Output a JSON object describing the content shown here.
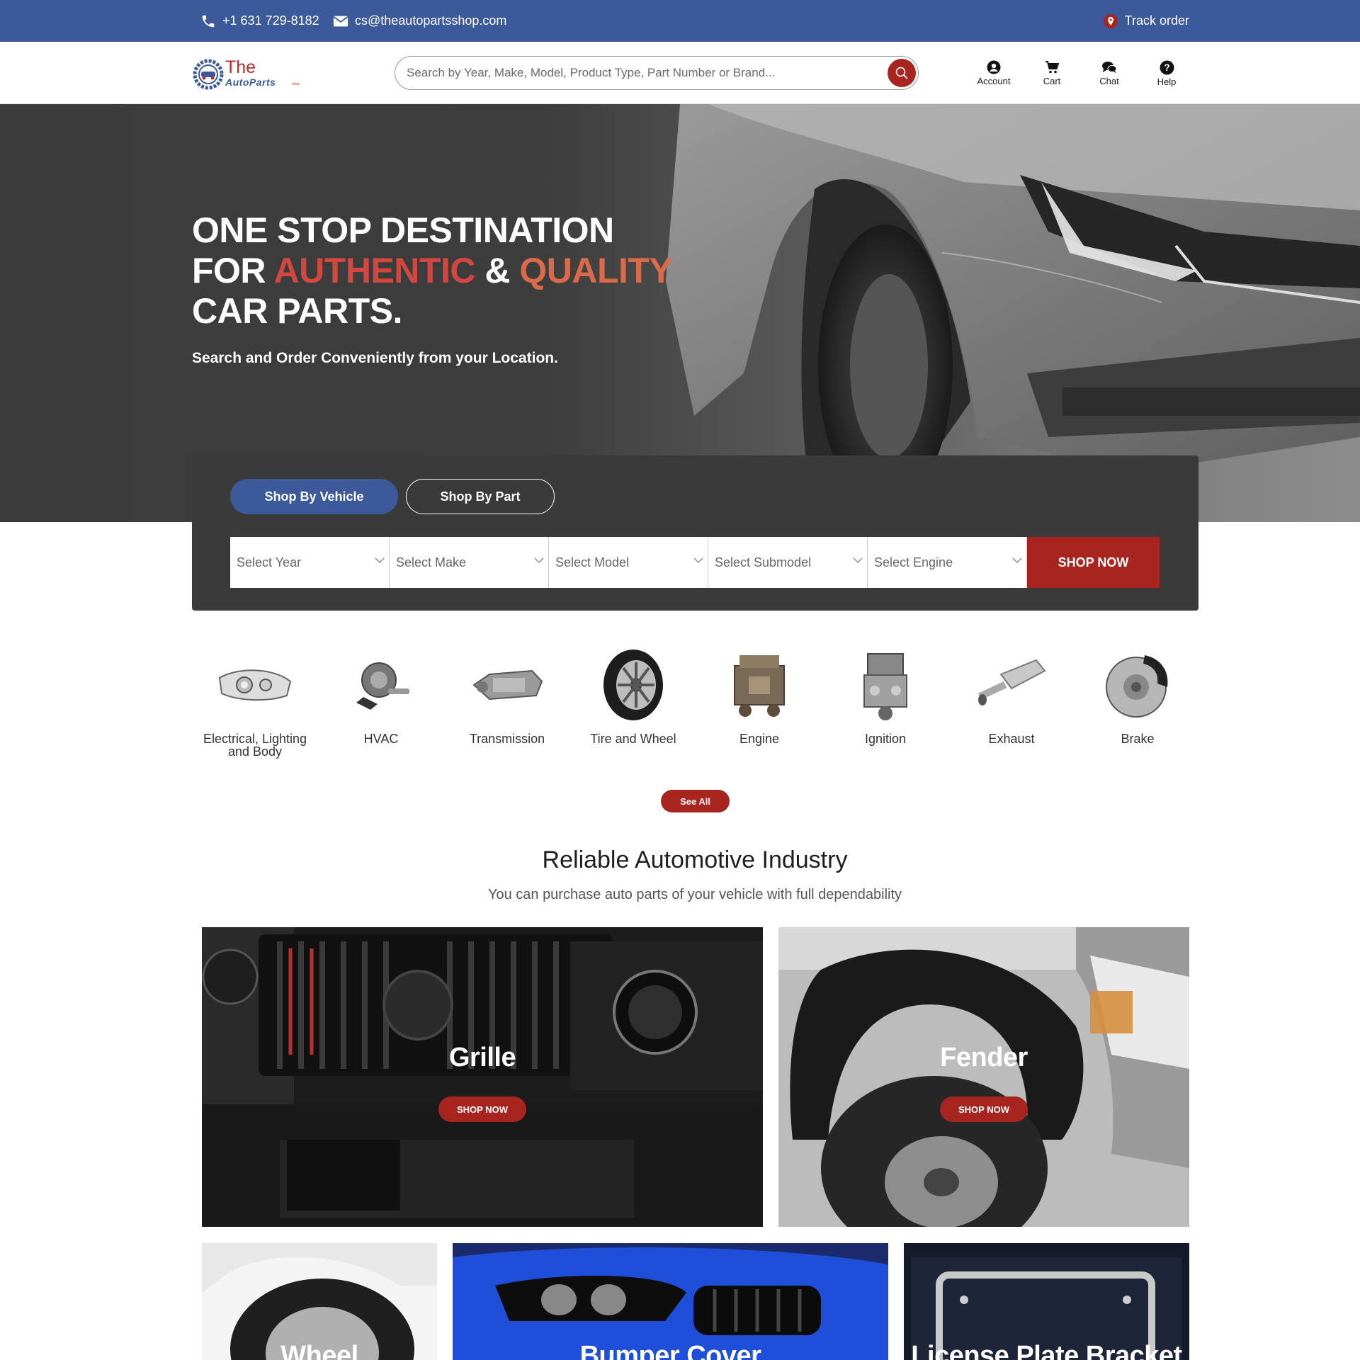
{
  "topbar": {
    "phone": "+1 631 729-8182",
    "email": "cs@theautopartsshop.com",
    "track": "Track order"
  },
  "brand": {
    "line1": "The",
    "line2": "AutoParts",
    "line3": "shop"
  },
  "search": {
    "placeholder": "Search by Year, Make, Model, Product Type, Part Number or Brand..."
  },
  "header_icons": [
    {
      "label": "Account",
      "icon": "account-icon"
    },
    {
      "label": "Cart",
      "icon": "cart-icon"
    },
    {
      "label": "Chat",
      "icon": "chat-icon"
    },
    {
      "label": "Help",
      "icon": "help-icon"
    }
  ],
  "hero": {
    "line1": "ONE STOP DESTINATION",
    "line2_a": "FOR ",
    "line2_b": "AUTHENTIC",
    "line2_c": " & ",
    "line2_d": "QUALITY",
    "line3": "CAR PARTS.",
    "subtitle": "Search and Order Conveniently from your Location."
  },
  "finder": {
    "tabs": [
      "Shop By Vehicle",
      "Shop By Part"
    ],
    "selects": [
      "Select Year",
      "Select Make",
      "Select Model",
      "Select Submodel",
      "Select Engine"
    ],
    "submit": "SHOP NOW"
  },
  "categories": [
    {
      "name": "Electrical, Lighting and Body",
      "icon": "headlight-icon"
    },
    {
      "name": "HVAC",
      "icon": "hvac-valve-icon"
    },
    {
      "name": "Transmission",
      "icon": "transmission-icon"
    },
    {
      "name": "Tire and Wheel",
      "icon": "tire-icon"
    },
    {
      "name": "Engine",
      "icon": "engine-icon"
    },
    {
      "name": "Ignition",
      "icon": "ignition-icon"
    },
    {
      "name": "Exhaust",
      "icon": "muffler-icon"
    },
    {
      "name": "Brake",
      "icon": "brake-disc-icon"
    }
  ],
  "see_all": "See All",
  "section": {
    "title": "Reliable Automotive Industry",
    "subtitle": "You can purchase auto parts of your vehicle with full dependability"
  },
  "tiles": [
    {
      "name": "Grille",
      "button": "SHOP NOW"
    },
    {
      "name": "Fender",
      "button": "SHOP NOW"
    },
    {
      "name": "Wheel"
    },
    {
      "name": "Bumper Cover"
    },
    {
      "name": "License Plate Bracket"
    }
  ],
  "colors": {
    "brand_blue": "#3c5a99",
    "accent_red": "#a8241f",
    "hero_red": "#d2473f",
    "hero_orange": "#d96a4a",
    "panel_dark": "#3a3a3a"
  }
}
